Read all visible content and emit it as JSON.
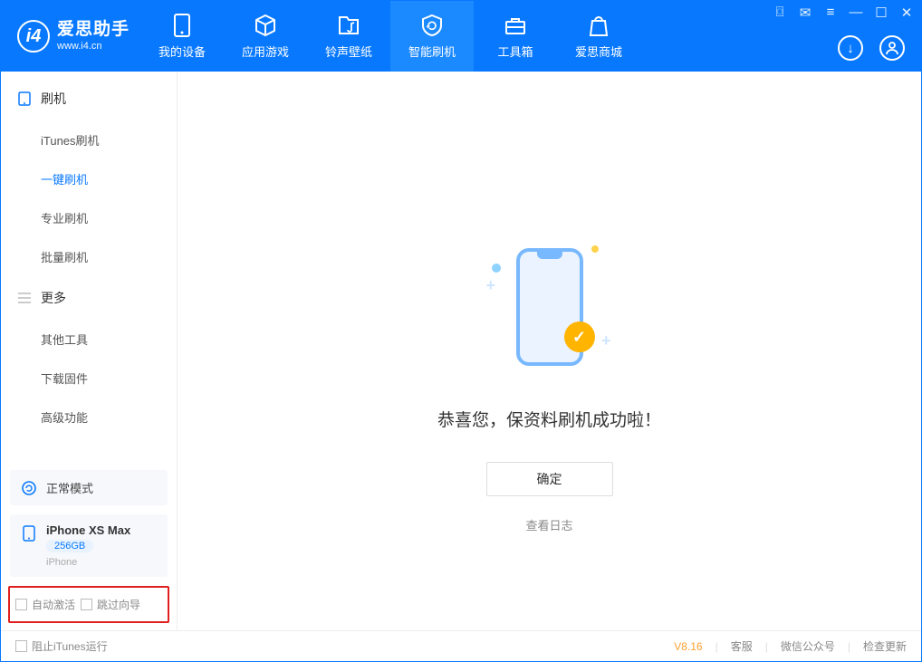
{
  "brand": {
    "name": "爱思助手",
    "url": "www.i4.cn"
  },
  "tabs": [
    {
      "label": "我的设备"
    },
    {
      "label": "应用游戏"
    },
    {
      "label": "铃声壁纸"
    },
    {
      "label": "智能刷机"
    },
    {
      "label": "工具箱"
    },
    {
      "label": "爱思商城"
    }
  ],
  "sidebar": {
    "group_flash": "刷机",
    "items_flash": [
      {
        "label": "iTunes刷机"
      },
      {
        "label": "一键刷机"
      },
      {
        "label": "专业刷机"
      },
      {
        "label": "批量刷机"
      }
    ],
    "group_more": "更多",
    "items_more": [
      {
        "label": "其他工具"
      },
      {
        "label": "下载固件"
      },
      {
        "label": "高级功能"
      }
    ],
    "status_mode": "正常模式",
    "device": {
      "name": "iPhone XS Max",
      "capacity": "256GB",
      "type": "iPhone"
    },
    "cb_auto_activate": "自动激活",
    "cb_skip_guide": "跳过向导"
  },
  "main": {
    "success_text": "恭喜您，保资料刷机成功啦！",
    "ok_button": "确定",
    "view_log": "查看日志"
  },
  "statusbar": {
    "block_itunes": "阻止iTunes运行",
    "version": "V8.16",
    "service": "客服",
    "wechat": "微信公众号",
    "check_update": "检查更新"
  }
}
